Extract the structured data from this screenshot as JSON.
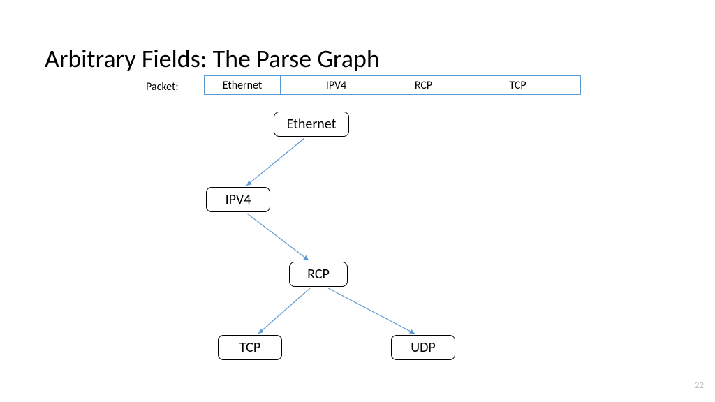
{
  "title": "Arbitrary Fields: The Parse Graph",
  "packet": {
    "label": "Packet:",
    "cells": {
      "ethernet": "Ethernet",
      "ipv4": "IPV4",
      "rcp": "RCP",
      "tcp": "TCP"
    }
  },
  "nodes": {
    "ethernet": "Ethernet",
    "ipv4": "IPV4",
    "rcp": "RCP",
    "tcp": "TCP",
    "udp": "UDP"
  },
  "edges": [
    {
      "from": "ethernet",
      "to": "ipv4"
    },
    {
      "from": "ipv4",
      "to": "rcp"
    },
    {
      "from": "rcp",
      "to": "tcp"
    },
    {
      "from": "rcp",
      "to": "udp"
    }
  ],
  "page_number": "22",
  "colors": {
    "arrow": "#5b9bd5",
    "cell_border": "#5b9bd5"
  }
}
